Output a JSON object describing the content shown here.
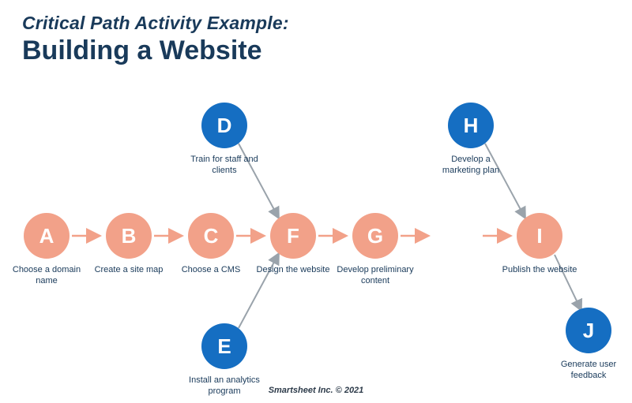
{
  "title": {
    "sup": "Critical Path Activity Example:",
    "main": "Building a Website"
  },
  "nodes": {
    "A": {
      "letter": "A",
      "label": "Choose a domain name"
    },
    "B": {
      "letter": "B",
      "label": "Create a site map"
    },
    "C": {
      "letter": "C",
      "label": "Choose a CMS"
    },
    "D": {
      "letter": "D",
      "label": "Train for staff and clients"
    },
    "E": {
      "letter": "E",
      "label": "Install an analytics program"
    },
    "F": {
      "letter": "F",
      "label": "Design the website"
    },
    "G": {
      "letter": "G",
      "label": "Develop preliminary content"
    },
    "H": {
      "letter": "H",
      "label": "Develop a marketing plan"
    },
    "I": {
      "letter": "I",
      "label": "Publish the website"
    },
    "J": {
      "letter": "J",
      "label": "Generate user feedback"
    }
  },
  "footer": "Smartsheet Inc. © 2021"
}
